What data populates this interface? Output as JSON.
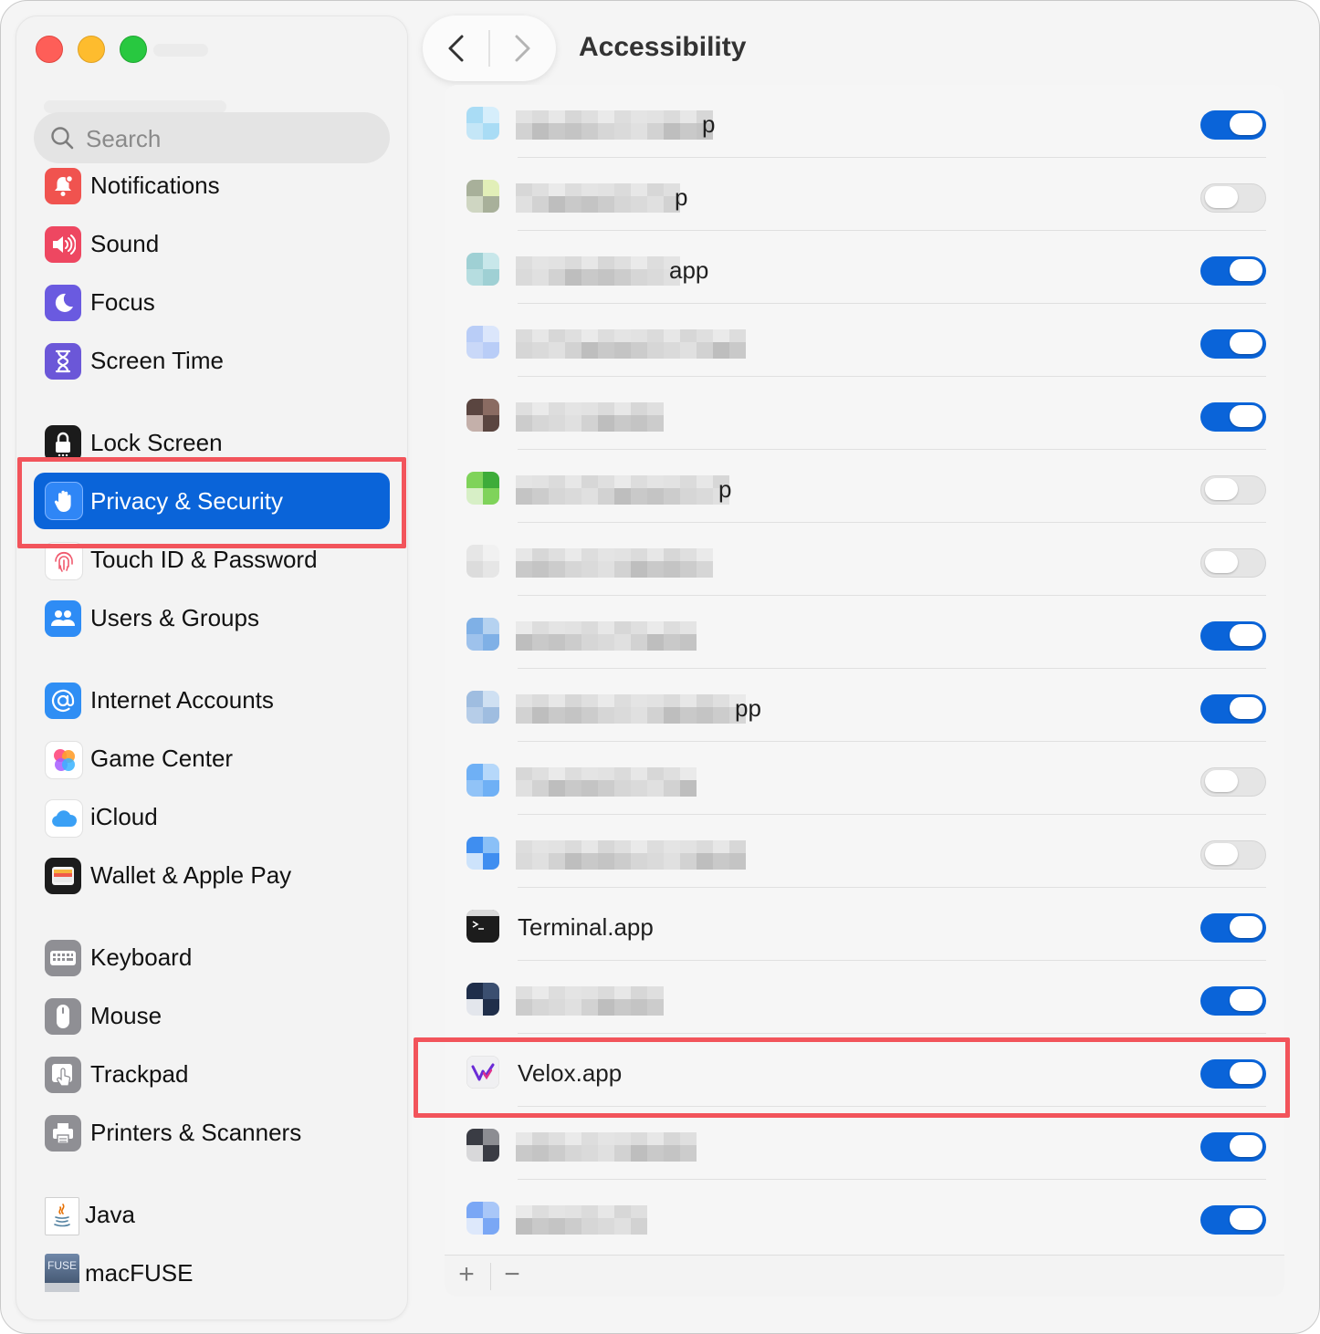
{
  "window": {
    "title": "Accessibility"
  },
  "search": {
    "placeholder": "Search"
  },
  "sidebar": {
    "items": [
      {
        "label": "Notifications",
        "icon": "bell-icon"
      },
      {
        "label": "Sound",
        "icon": "speaker-icon"
      },
      {
        "label": "Focus",
        "icon": "moon-icon"
      },
      {
        "label": "Screen Time",
        "icon": "hourglass-icon"
      },
      {
        "label": "Lock Screen",
        "icon": "lock-icon"
      },
      {
        "label": "Privacy & Security",
        "icon": "hand-icon",
        "selected": true
      },
      {
        "label": "Touch ID & Password",
        "icon": "fingerprint-icon"
      },
      {
        "label": "Users & Groups",
        "icon": "users-icon"
      },
      {
        "label": "Internet Accounts",
        "icon": "at-sign-icon"
      },
      {
        "label": "Game Center",
        "icon": "game-center-icon"
      },
      {
        "label": "iCloud",
        "icon": "cloud-icon"
      },
      {
        "label": "Wallet & Apple Pay",
        "icon": "wallet-icon"
      },
      {
        "label": "Keyboard",
        "icon": "keyboard-icon"
      },
      {
        "label": "Mouse",
        "icon": "mouse-icon"
      },
      {
        "label": "Trackpad",
        "icon": "trackpad-icon"
      },
      {
        "label": "Printers & Scanners",
        "icon": "printer-icon"
      },
      {
        "label": "Java",
        "icon": "java-icon"
      },
      {
        "label": "macFUSE",
        "icon": "macfuse-icon"
      }
    ]
  },
  "apps": [
    {
      "name": "",
      "visible_suffix": "p",
      "enabled": true
    },
    {
      "name": "",
      "visible_suffix": "p",
      "enabled": false
    },
    {
      "name": "",
      "visible_suffix": "app",
      "enabled": true
    },
    {
      "name": "",
      "visible_suffix": "",
      "enabled": true
    },
    {
      "name": "",
      "visible_suffix": "",
      "enabled": true
    },
    {
      "name": "",
      "visible_suffix": "p",
      "enabled": false
    },
    {
      "name": "",
      "visible_suffix": "",
      "enabled": false
    },
    {
      "name": "",
      "visible_suffix": "",
      "enabled": true
    },
    {
      "name": "",
      "visible_suffix": "pp",
      "enabled": true
    },
    {
      "name": "",
      "visible_suffix": "",
      "enabled": false
    },
    {
      "name": "",
      "visible_suffix": "",
      "enabled": false
    },
    {
      "name": "Terminal.app",
      "visible_suffix": "",
      "enabled": true,
      "icon": "terminal-icon"
    },
    {
      "name": "",
      "visible_suffix": "",
      "enabled": true
    },
    {
      "name": "Velox.app",
      "visible_suffix": "",
      "enabled": true,
      "icon": "velox-icon",
      "highlighted": true
    },
    {
      "name": "",
      "visible_suffix": "",
      "enabled": true
    },
    {
      "name": "",
      "visible_suffix": "",
      "enabled": true
    }
  ],
  "footer": {
    "add_label": "+",
    "remove_label": "−"
  },
  "colors": {
    "accent": "#0a64d9",
    "highlight": "#f2545b"
  }
}
